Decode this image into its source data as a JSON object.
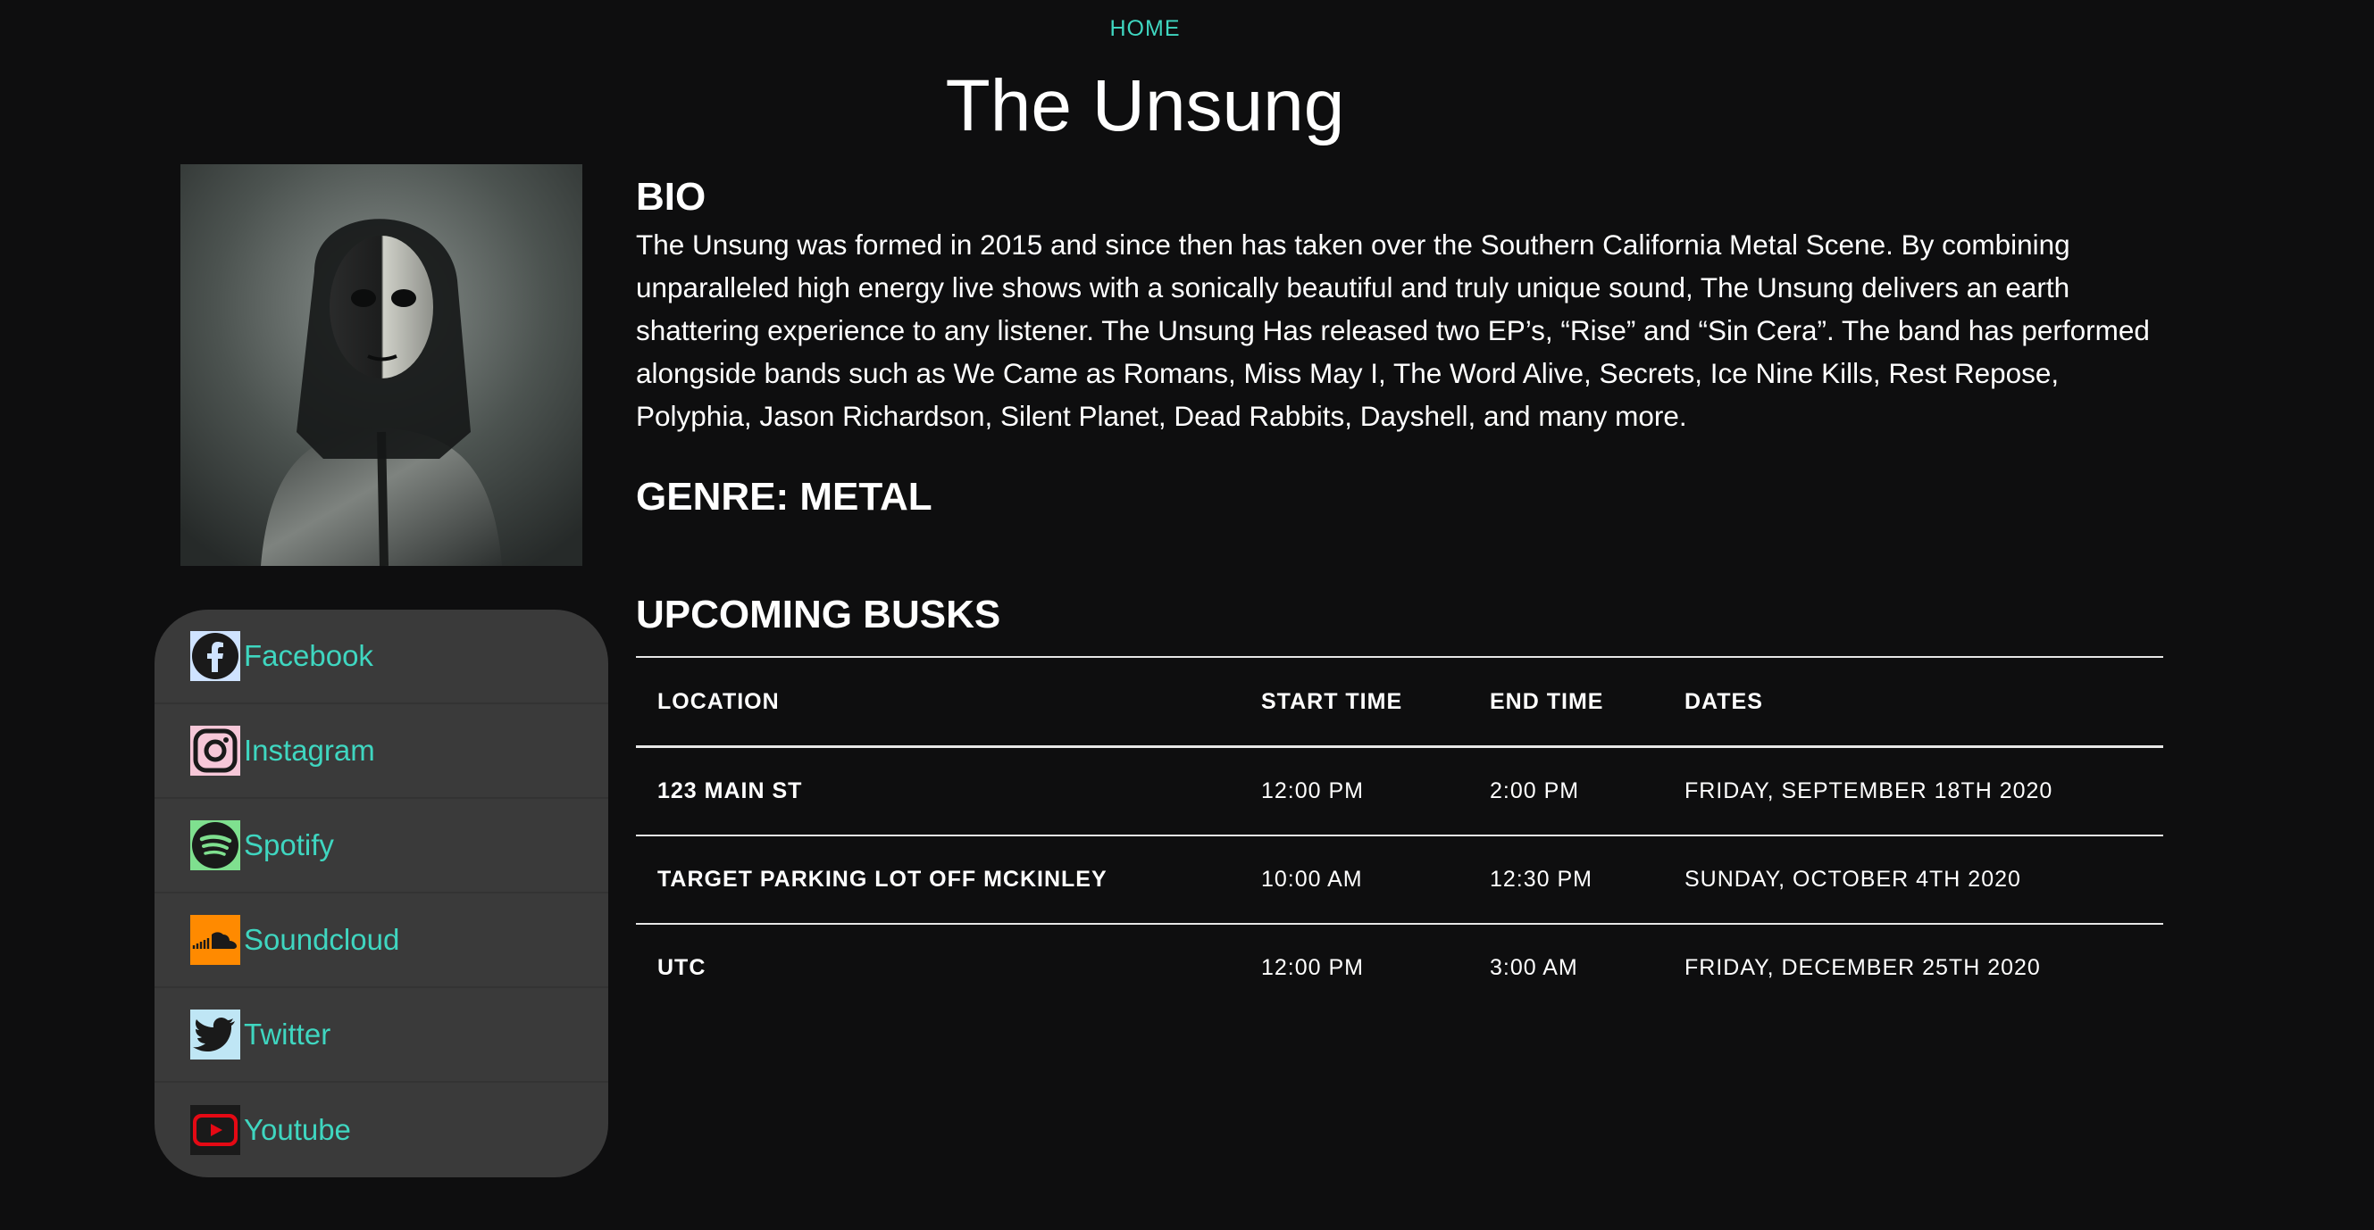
{
  "nav": {
    "home_label": "HOME"
  },
  "page_title": "The Unsung",
  "bio": {
    "heading": "BIO",
    "text": "The Unsung was formed in 2015 and since then has taken over the Southern California Metal Scene. By combining unparalleled high energy live shows with a sonically beautiful and truly unique sound, The Unsung delivers an earth shattering experience to any listener. The Unsung Has released two EP’s, “Rise” and “Sin Cera”. The band has performed alongside bands such as We Came as Romans, Miss May I, The Word Alive, Secrets, Ice Nine Kills, Rest Repose, Polyphia, Jason Richardson, Silent Planet, Dead Rabbits, Dayshell, and many more."
  },
  "genre": "GENRE: METAL",
  "social": {
    "items": [
      {
        "label": "Facebook",
        "icon": "facebook-icon"
      },
      {
        "label": "Instagram",
        "icon": "instagram-icon"
      },
      {
        "label": "Spotify",
        "icon": "spotify-icon"
      },
      {
        "label": "Soundcloud",
        "icon": "soundcloud-icon"
      },
      {
        "label": "Twitter",
        "icon": "twitter-icon"
      },
      {
        "label": "Youtube",
        "icon": "youtube-icon"
      }
    ]
  },
  "busks": {
    "heading": "UPCOMING BUSKS",
    "columns": [
      "LOCATION",
      "START TIME",
      "END TIME",
      "DATES"
    ],
    "rows": [
      [
        "123 MAIN ST",
        "12:00 PM",
        "2:00 PM",
        "FRIDAY, SEPTEMBER 18TH 2020"
      ],
      [
        "TARGET PARKING LOT OFF MCKINLEY",
        "10:00 AM",
        "12:30 PM",
        "SUNDAY, OCTOBER 4TH 2020"
      ],
      [
        "UTC",
        "12:00 PM",
        "3:00 AM",
        "FRIDAY, DECEMBER 25TH 2020"
      ]
    ]
  },
  "colors": {
    "background": "#0e0e0f",
    "accent": "#3fd6c0",
    "panel": "#3a3a3a"
  }
}
